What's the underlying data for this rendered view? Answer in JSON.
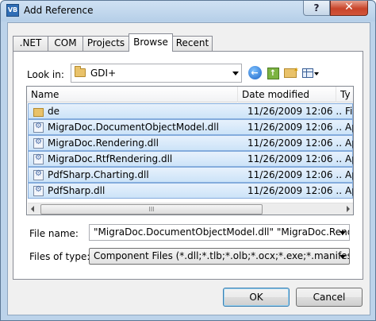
{
  "window": {
    "title": "Add Reference",
    "help_label": "?",
    "close_label": "✕",
    "icon_text": "VB"
  },
  "tabs": [
    {
      "label": ".NET"
    },
    {
      "label": "COM"
    },
    {
      "label": "Projects"
    },
    {
      "label": "Browse"
    },
    {
      "label": "Recent"
    }
  ],
  "active_tab": "Browse",
  "look_in": {
    "label": "Look in:",
    "value": "GDI+"
  },
  "toolbar_icons": [
    "back-icon",
    "up-folder-icon",
    "new-folder-icon",
    "views-menu-icon"
  ],
  "file_list": {
    "columns": [
      {
        "label": "Name"
      },
      {
        "label": "Date modified"
      },
      {
        "label": "Ty"
      }
    ],
    "rows": [
      {
        "name": "de",
        "date": "11/26/2009 12:06 ...",
        "type": "Fi",
        "kind": "folder"
      },
      {
        "name": "MigraDoc.DocumentObjectModel.dll",
        "date": "11/26/2009 12:06 ...",
        "type": "Ap",
        "kind": "dll"
      },
      {
        "name": "MigraDoc.Rendering.dll",
        "date": "11/26/2009 12:06 ...",
        "type": "Ap",
        "kind": "dll"
      },
      {
        "name": "MigraDoc.RtfRendering.dll",
        "date": "11/26/2009 12:06 ...",
        "type": "Ap",
        "kind": "dll"
      },
      {
        "name": "PdfSharp.Charting.dll",
        "date": "11/26/2009 12:06 ...",
        "type": "Ap",
        "kind": "dll"
      },
      {
        "name": "PdfSharp.dll",
        "date": "11/26/2009 12:06 ...",
        "type": "Ap",
        "kind": "dll"
      }
    ],
    "scroll_grip": "III"
  },
  "file_name": {
    "label": "File name:",
    "value": "\"MigraDoc.DocumentObjectModel.dll\" \"MigraDoc.Rendering.dll\""
  },
  "file_type": {
    "label": "Files of type:",
    "value": "Component Files (*.dll;*.tlb;*.olb;*.ocx;*.exe;*.manifest)"
  },
  "buttons": {
    "ok": "OK",
    "cancel": "Cancel"
  }
}
